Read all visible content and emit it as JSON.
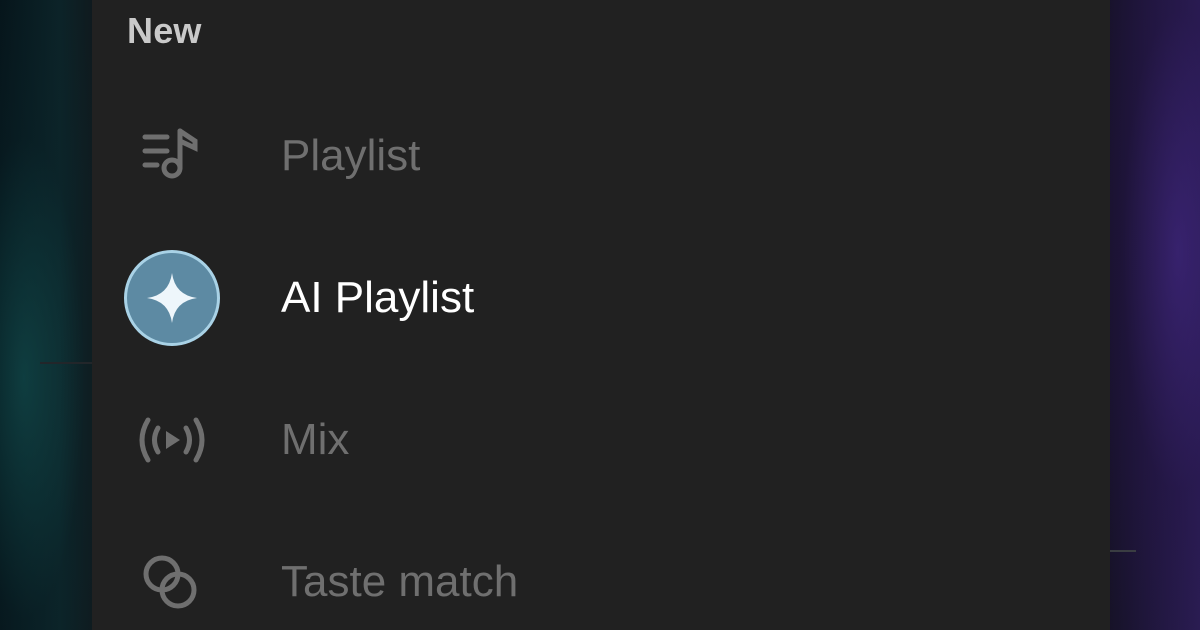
{
  "menu": {
    "title": "New",
    "items": [
      {
        "label": "Playlist",
        "icon": "playlist-music-icon",
        "state": "disabled"
      },
      {
        "label": "AI Playlist",
        "icon": "ai-sparkle-icon",
        "state": "active"
      },
      {
        "label": "Mix",
        "icon": "radio-broadcast-icon",
        "state": "disabled"
      },
      {
        "label": "Taste match",
        "icon": "overlapping-circles-icon",
        "state": "disabled"
      }
    ]
  },
  "colors": {
    "sheet_background": "#212121",
    "disabled_text": "#6f6f6f",
    "active_text": "#ffffff",
    "title_text": "#c9c9c9",
    "ai_accent": "#5d8aa3",
    "ai_accent_border": "#a9d2e6"
  }
}
